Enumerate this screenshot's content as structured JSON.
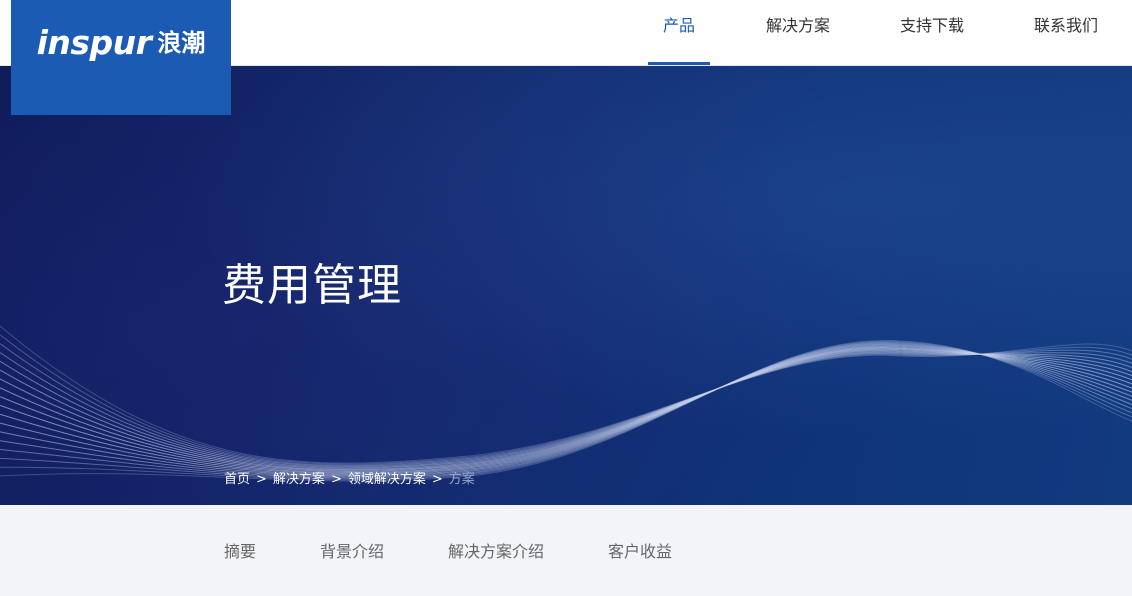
{
  "logo": {
    "brand_en": "inspur",
    "brand_cn": "浪潮",
    "background_color": "#1c5bb3"
  },
  "nav": {
    "items": [
      {
        "label": "产品",
        "active": true
      },
      {
        "label": "解决方案",
        "active": false
      },
      {
        "label": "支持下载",
        "active": false
      },
      {
        "label": "联系我们",
        "active": false
      }
    ],
    "active_color": "#1c5bb3"
  },
  "banner": {
    "title": "费用管理",
    "breadcrumb": [
      {
        "label": "首页"
      },
      {
        "label": "解决方案"
      },
      {
        "label": "领域解决方案"
      },
      {
        "label": "方案"
      }
    ],
    "separator": ">"
  },
  "subnav": {
    "items": [
      {
        "label": "摘要"
      },
      {
        "label": "背景介绍"
      },
      {
        "label": "解决方案介绍"
      },
      {
        "label": "客户收益"
      }
    ]
  }
}
